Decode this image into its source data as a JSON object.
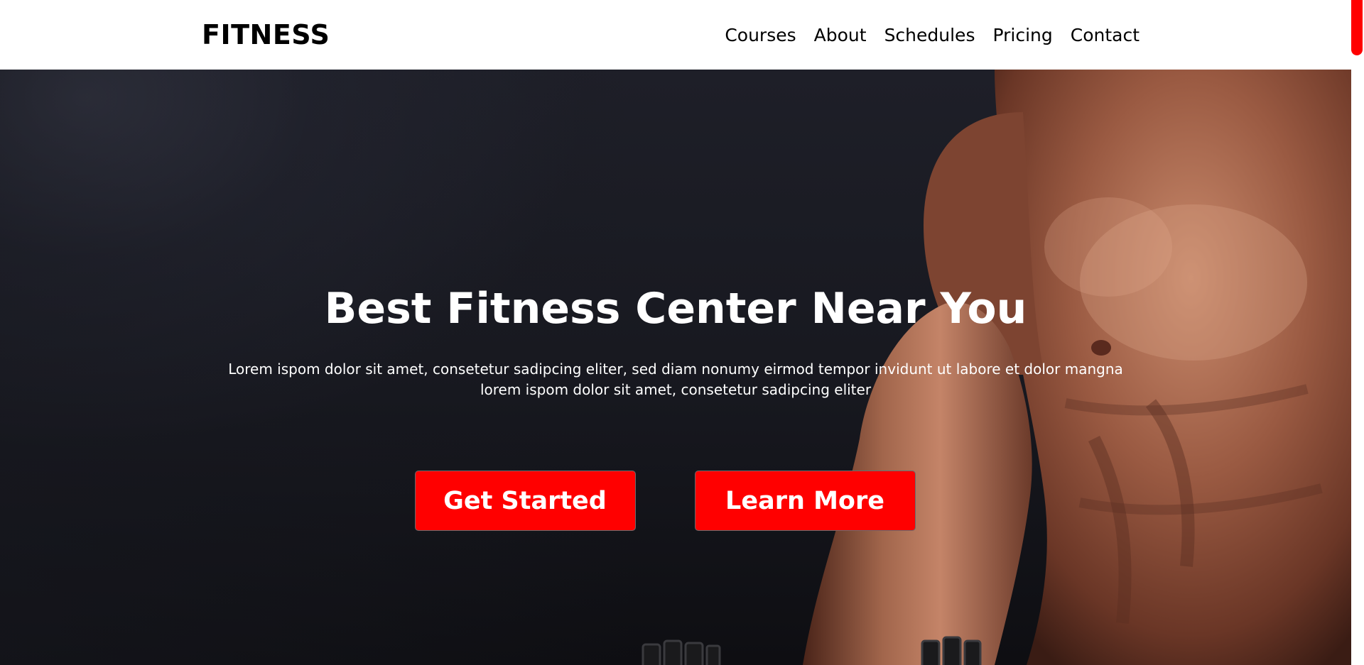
{
  "brand": {
    "logo": "FITNESS"
  },
  "nav": {
    "items": [
      {
        "label": "Courses"
      },
      {
        "label": "About"
      },
      {
        "label": "Schedules"
      },
      {
        "label": "Pricing"
      },
      {
        "label": "Contact"
      }
    ]
  },
  "hero": {
    "title": "Best Fitness Center Near You",
    "subtitle": "Lorem ispom dolor sit amet, consetetur sadipcing eliter, sed diam nonumy eirmod tempor invidunt ut labore et dolor mangna lorem ispom dolor sit amet, consetetur sadipcing eliter",
    "primary_button": "Get Started",
    "secondary_button": "Learn More",
    "image_subject": "muscular man holding dumbbells"
  },
  "colors": {
    "accent": "#ff0000",
    "nav_background": "#ffffff",
    "hero_background": "#17181f",
    "hero_text": "#ffffff"
  }
}
